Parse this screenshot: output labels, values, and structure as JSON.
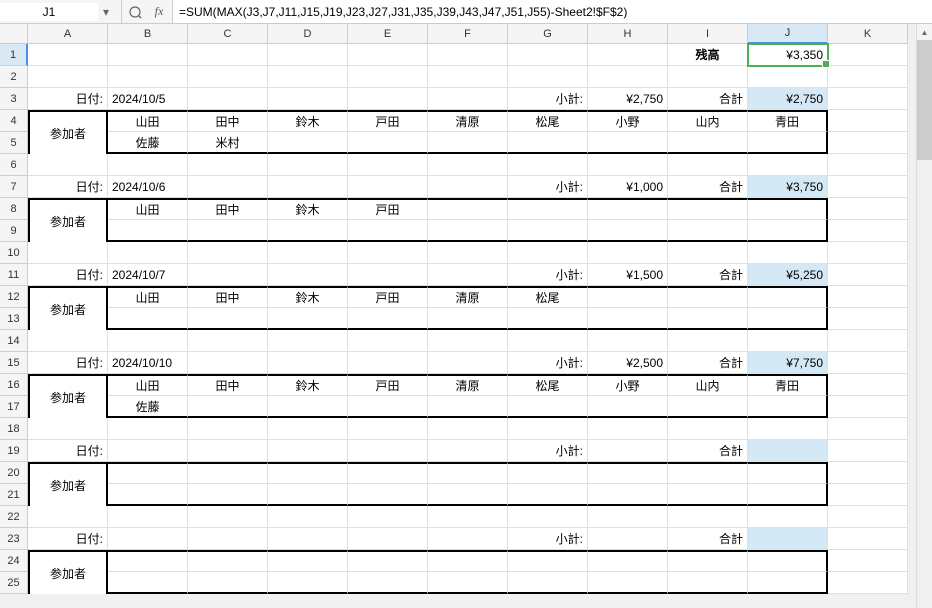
{
  "formula_bar": {
    "cell_ref": "J1",
    "formula": "=SUM(MAX(J3,J7,J11,J15,J19,J23,J27,J31,J35,J39,J43,J47,J51,J55)-Sheet2!$F$2)"
  },
  "columns": [
    "A",
    "B",
    "C",
    "D",
    "E",
    "F",
    "G",
    "H",
    "I",
    "J",
    "K"
  ],
  "selected_col": "J",
  "selected_row": 1,
  "labels": {
    "balance": "残高",
    "date": "日付:",
    "subtotal": "小計:",
    "total": "合計",
    "participants": "参加者"
  },
  "header": {
    "balance_value": "¥3,350"
  },
  "blocks": [
    {
      "date": "2024/10/5",
      "subtotal": "¥2,750",
      "total": "¥2,750",
      "names_row1": [
        "山田",
        "田中",
        "鈴木",
        "戸田",
        "清原",
        "松尾",
        "小野",
        "山内",
        "青田"
      ],
      "names_row2": [
        "佐藤",
        "米村",
        "",
        "",
        "",
        "",
        "",
        "",
        ""
      ]
    },
    {
      "date": "2024/10/6",
      "subtotal": "¥1,000",
      "total": "¥3,750",
      "names_row1": [
        "山田",
        "田中",
        "鈴木",
        "戸田",
        "",
        "",
        "",
        "",
        ""
      ],
      "names_row2": [
        "",
        "",
        "",
        "",
        "",
        "",
        "",
        "",
        ""
      ]
    },
    {
      "date": "2024/10/7",
      "subtotal": "¥1,500",
      "total": "¥5,250",
      "names_row1": [
        "山田",
        "田中",
        "鈴木",
        "戸田",
        "清原",
        "松尾",
        "",
        "",
        ""
      ],
      "names_row2": [
        "",
        "",
        "",
        "",
        "",
        "",
        "",
        "",
        ""
      ]
    },
    {
      "date": "2024/10/10",
      "subtotal": "¥2,500",
      "total": "¥7,750",
      "names_row1": [
        "山田",
        "田中",
        "鈴木",
        "戸田",
        "清原",
        "松尾",
        "小野",
        "山内",
        "青田"
      ],
      "names_row2": [
        "佐藤",
        "",
        "",
        "",
        "",
        "",
        "",
        "",
        ""
      ]
    },
    {
      "date": "",
      "subtotal": "",
      "total": "",
      "names_row1": [
        "",
        "",
        "",
        "",
        "",
        "",
        "",
        "",
        ""
      ],
      "names_row2": [
        "",
        "",
        "",
        "",
        "",
        "",
        "",
        "",
        ""
      ]
    },
    {
      "date": "",
      "subtotal": "",
      "total": "",
      "names_row1": [
        "",
        "",
        "",
        "",
        "",
        "",
        "",
        "",
        ""
      ],
      "names_row2": [
        "",
        "",
        "",
        "",
        "",
        "",
        "",
        "",
        ""
      ]
    }
  ]
}
